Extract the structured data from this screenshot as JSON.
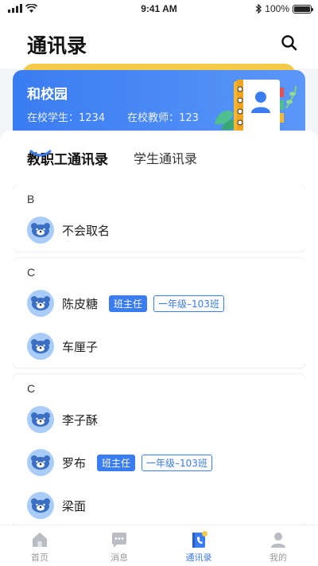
{
  "status_bar": {
    "time": "9:41 AM",
    "battery": "100%",
    "battery_level": 1.0
  },
  "header": {
    "title": "通讯录"
  },
  "school": {
    "name": "和校园",
    "students": "在校学生：1234",
    "teachers": "在校教师：123"
  },
  "tabs": [
    {
      "label": "教职工通讯录",
      "active": true
    },
    {
      "label": "学生通讯录",
      "active": false
    }
  ],
  "groups": [
    {
      "letter": "B",
      "contacts": [
        {
          "name": "不会取名",
          "role": "",
          "class": ""
        }
      ]
    },
    {
      "letter": "C",
      "contacts": [
        {
          "name": "陈皮糖",
          "role": "班主任",
          "class": "一年级–103班"
        },
        {
          "name": "车厘子",
          "role": "",
          "class": ""
        }
      ]
    },
    {
      "letter": "C",
      "contacts": [
        {
          "name": "李子酥",
          "role": "",
          "class": ""
        },
        {
          "name": "罗布",
          "role": "班主任",
          "class": "一年级–103班"
        },
        {
          "name": "梁面",
          "role": "",
          "class": ""
        }
      ]
    }
  ],
  "bottom_nav": [
    {
      "label": "首页",
      "icon": "home-icon",
      "active": false
    },
    {
      "label": "消息",
      "icon": "message-icon",
      "active": false
    },
    {
      "label": "通讯录",
      "icon": "contacts-icon",
      "active": true
    },
    {
      "label": "我的",
      "icon": "profile-icon",
      "active": false
    }
  ],
  "colors": {
    "accent": "#3a7cf2",
    "avatar_bg": "#a9cdf8",
    "banner_tab": "#f5c94a"
  }
}
